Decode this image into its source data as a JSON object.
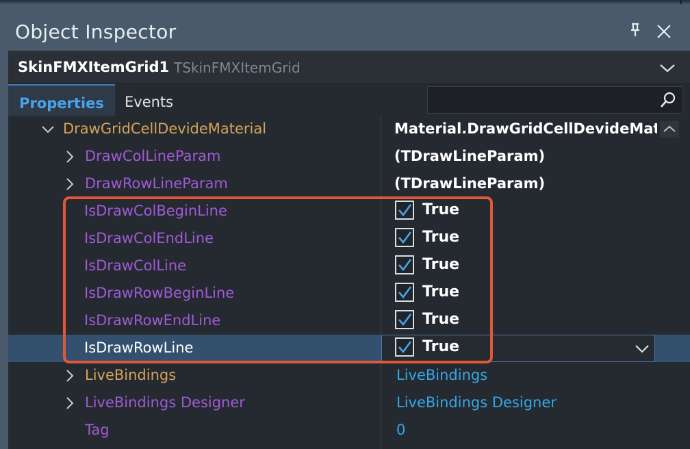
{
  "window": {
    "title": "Object Inspector"
  },
  "object_selector": {
    "name": "SkinFMXItemGrid1",
    "type": "TSkinFMXItemGrid"
  },
  "tabs": [
    {
      "label": "Properties",
      "active": true
    },
    {
      "label": "Events",
      "active": false
    }
  ],
  "search": {
    "value": ""
  },
  "properties": [
    {
      "name": "DrawGridCellDevideMaterial",
      "value": "Material.DrawGridCellDevideMaterial",
      "expander": "expanded",
      "name_color": "gold"
    },
    {
      "name": "DrawColLineParam",
      "value": "(TDrawLineParam)",
      "expander": "collapsed",
      "name_color": "purple"
    },
    {
      "name": "DrawRowLineParam",
      "value": "(TDrawLineParam)",
      "expander": "collapsed",
      "name_color": "purple"
    },
    {
      "name": "IsDrawColBeginLine",
      "value": "True",
      "checked": true,
      "name_color": "purple"
    },
    {
      "name": "IsDrawColEndLine",
      "value": "True",
      "checked": true,
      "name_color": "purple"
    },
    {
      "name": "IsDrawColLine",
      "value": "True",
      "checked": true,
      "name_color": "purple"
    },
    {
      "name": "IsDrawRowBeginLine",
      "value": "True",
      "checked": true,
      "name_color": "purple"
    },
    {
      "name": "IsDrawRowEndLine",
      "value": "True",
      "checked": true,
      "name_color": "purple"
    },
    {
      "name": "IsDrawRowLine",
      "value": "True",
      "checked": true,
      "selected": true,
      "name_color": "white"
    },
    {
      "name": "LiveBindings",
      "value": "LiveBindings",
      "expander": "collapsed",
      "name_color": "gold"
    },
    {
      "name": "LiveBindings Designer",
      "value": "LiveBindings Designer",
      "expander": "collapsed",
      "name_color": "purple"
    },
    {
      "name": "Tag",
      "value": "0",
      "name_color": "purple"
    }
  ],
  "colors": {
    "accent": "#4aa3e8",
    "selection": "#34506f",
    "highlight_border": "#e0573a",
    "gold": "#d6a35b",
    "purple": "#a05ad8",
    "link_blue": "#34a8e8"
  },
  "icons": {
    "pin": "pin-icon",
    "close": "close-icon",
    "search": "search-icon",
    "dropdown": "chevron-down-icon",
    "expanded": "chevron-down-icon",
    "collapsed": "chevron-right-icon",
    "checkbox": "checkmark-icon"
  }
}
